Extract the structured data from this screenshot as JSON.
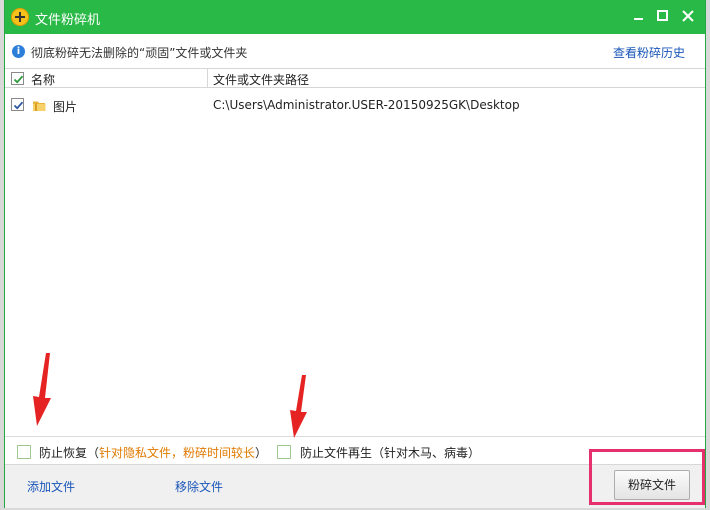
{
  "window": {
    "title": "文件粉碎机"
  },
  "info": {
    "text": "彻底粉碎无法删除的“顽固”文件或文件夹",
    "history_link": "查看粉碎历史"
  },
  "table": {
    "columns": [
      "名称",
      "文件或文件夹路径"
    ],
    "rows": [
      {
        "checked": true,
        "name": "图片",
        "path": "C:\\Users\\Administrator.USER-20150925GK\\Desktop"
      }
    ]
  },
  "options": {
    "prevent_recovery": {
      "label": "防止恢复",
      "open_paren": "（",
      "note": "针对隐私文件，粉碎时间较长",
      "close_paren": "）",
      "checked": false
    },
    "prevent_regeneration": {
      "label": "防止文件再生（针对木马、病毒）",
      "checked": false
    }
  },
  "actions": {
    "add_file": "添加文件",
    "remove_file": "移除文件",
    "shred_button": "粉碎文件"
  },
  "colors": {
    "titlebar": "#29b946",
    "link": "#1a56b8",
    "note": "#e07a00",
    "highlight": "#e6306e",
    "arrow": "#e52323"
  },
  "icons": {
    "app": "app-plus-icon",
    "info": "info-icon",
    "folder": "folder-icon",
    "minimize": "minimize-icon",
    "maximize": "maximize-icon",
    "close": "close-icon"
  }
}
